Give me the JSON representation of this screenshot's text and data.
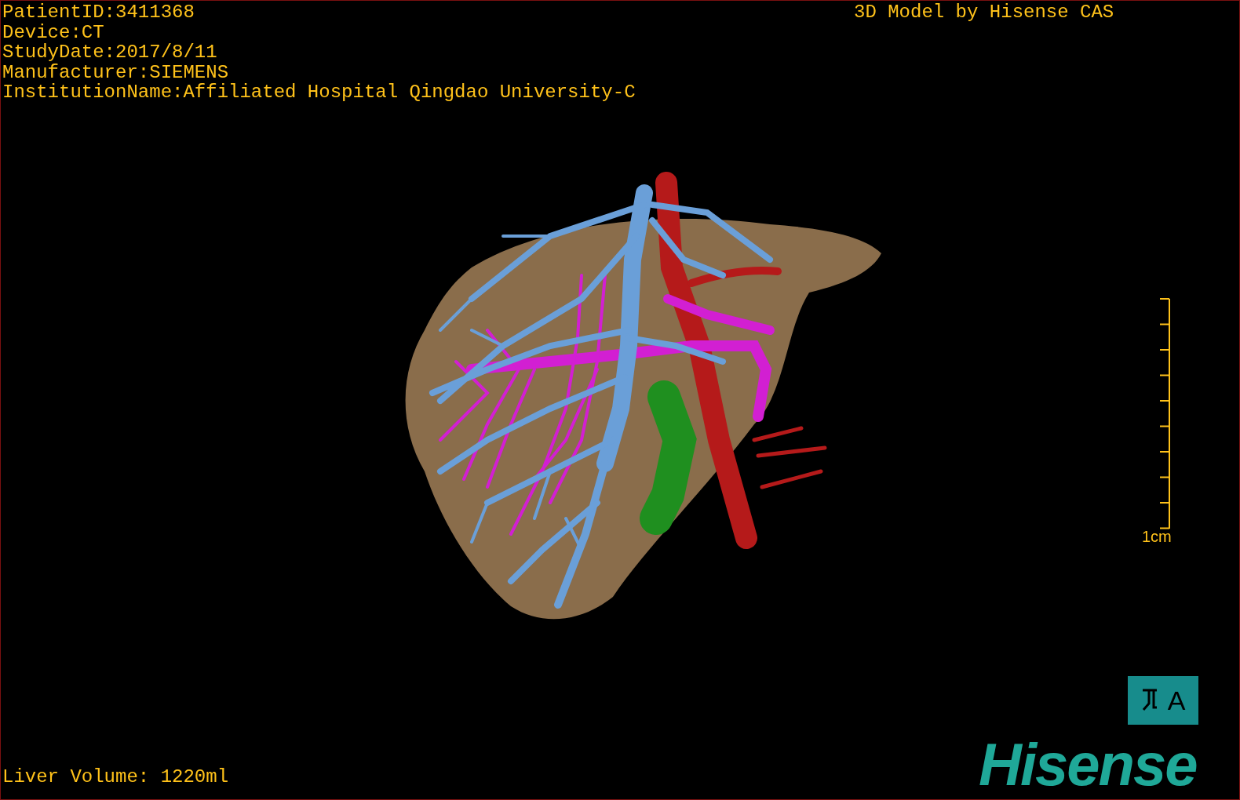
{
  "info_lines": [
    "PatientID:3411368",
    "Device:CT",
    "StudyDate:2017/8/11",
    "Manufacturer:SIEMENS",
    "InstitutionName:Affiliated Hospital Qingdao University-C"
  ],
  "title": "3D Model by Hisense CAS",
  "scale_bar": {
    "label": "1cm"
  },
  "orientation_marker": {
    "label": "A"
  },
  "liver_volume": "Liver Volume: 1220ml",
  "logo": "Hisense"
}
